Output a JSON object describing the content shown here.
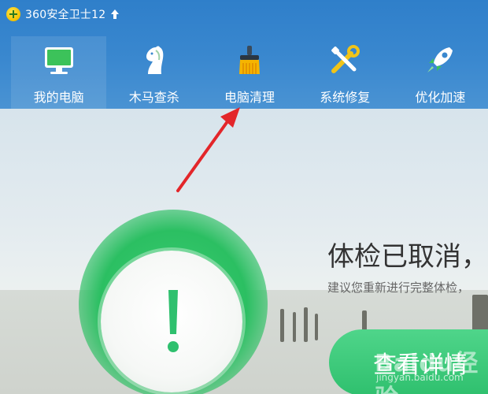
{
  "app": {
    "title": "360安全卫士12",
    "logo_icon": "plus-badge-icon",
    "upgrade_icon": "up-arrow-icon"
  },
  "nav": {
    "items": [
      {
        "label": "我的电脑",
        "icon": "monitor-icon",
        "active": true
      },
      {
        "label": "木马查杀",
        "icon": "horse-icon",
        "active": false
      },
      {
        "label": "电脑清理",
        "icon": "broom-icon",
        "active": false
      },
      {
        "label": "系统修复",
        "icon": "wrench-screwdriver-icon",
        "active": false
      },
      {
        "label": "优化加速",
        "icon": "rocket-icon",
        "active": false
      }
    ]
  },
  "status": {
    "title": "体检已取消，",
    "subtitle": "建议您重新进行完整体检，",
    "button_label": "查看详情",
    "indicator_icon": "exclamation-icon"
  },
  "annotation": {
    "arrow_color": "#e3262a",
    "target": "电脑清理"
  },
  "watermark": {
    "text": "Baidu经验",
    "url_text": "jingyan.baidu.com"
  },
  "colors": {
    "header_blue": "#3a88cf",
    "accent_green": "#2fc06e",
    "logo_yellow": "#f2c100"
  }
}
